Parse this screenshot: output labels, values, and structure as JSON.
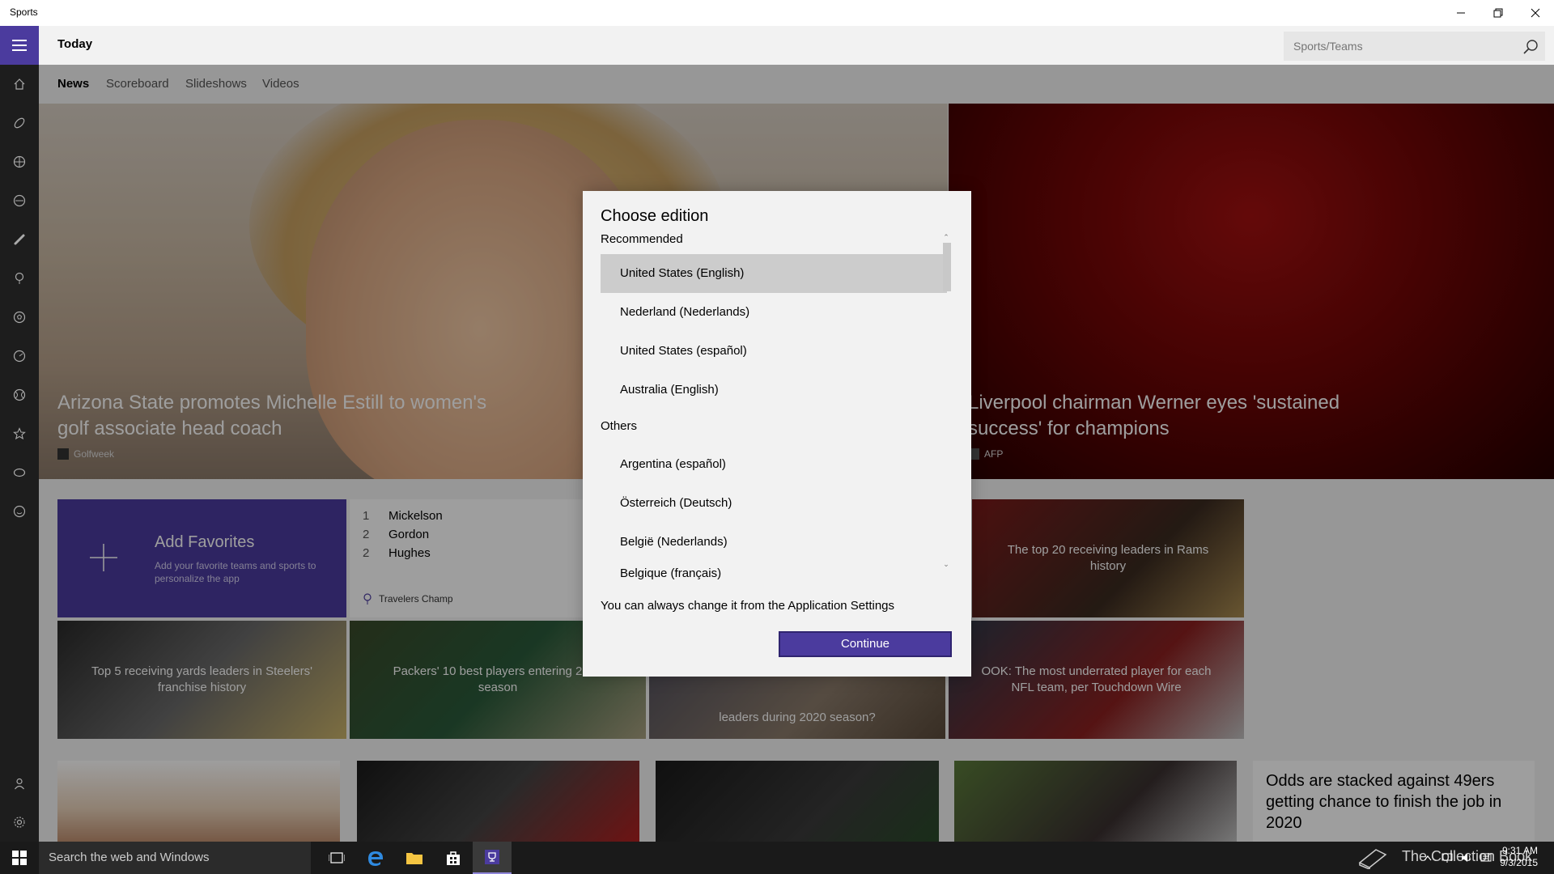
{
  "window": {
    "title": "Sports"
  },
  "header": {
    "page_title": "Today",
    "search_placeholder": "Sports/Teams"
  },
  "tabs": [
    {
      "label": "News"
    },
    {
      "label": "Scoreboard"
    },
    {
      "label": "Slideshows"
    },
    {
      "label": "Videos"
    }
  ],
  "hero": [
    {
      "title_line1": "Arizona State promotes Michelle Estill to women's",
      "title_line2": "golf associate head coach",
      "source": "Golfweek"
    },
    {
      "title_line1": "Liverpool chairman Werner eyes 'sustained",
      "title_line2": "success' for champions",
      "source": "AFP"
    }
  ],
  "favorites": {
    "title": "Add Favorites",
    "subtitle": "Add your favorite teams and sports to personalize the app"
  },
  "leaderboard": {
    "rows": [
      {
        "rank": "1",
        "name": "Mickelson"
      },
      {
        "rank": "2",
        "name": "Gordon"
      },
      {
        "rank": "2",
        "name": "Hughes"
      }
    ],
    "event": "Travelers Champ"
  },
  "tiles": [
    {
      "caption": "The top 20 receiving leaders in Rams history"
    },
    {
      "caption": "Top 5 receiving yards leaders in Steelers' franchise history"
    },
    {
      "caption": "Packers' 10 best players entering 2020 season"
    },
    {
      "caption": "leaders during 2020 season?"
    },
    {
      "caption": "OOK: The most underrated player for each NFL team, per Touchdown Wire"
    }
  ],
  "odds": {
    "title": "Odds are stacked against 49ers getting chance to finish the job in 2020"
  },
  "dialog": {
    "title": "Choose edition",
    "recommended_label": "Recommended",
    "others_label": "Others",
    "recommended": [
      {
        "label": "United States (English)",
        "selected": true
      },
      {
        "label": "Nederland (Nederlands)"
      },
      {
        "label": "United States (español)"
      },
      {
        "label": "Australia (English)"
      }
    ],
    "others": [
      {
        "label": "Argentina (español)"
      },
      {
        "label": "Österreich (Deutsch)"
      },
      {
        "label": "België (Nederlands)"
      },
      {
        "label": "Belgique (français)"
      }
    ],
    "note": "You can always change it from the Application Settings",
    "continue_label": "Continue"
  },
  "taskbar": {
    "search_placeholder": "Search the web and Windows",
    "time": "9:31 AM",
    "date": "9/3/2015",
    "watermark": "The Collection Book"
  },
  "colors": {
    "accent": "#4b3b9e",
    "rail": "#1d1d1d",
    "taskbar": "#1a1a1a"
  }
}
